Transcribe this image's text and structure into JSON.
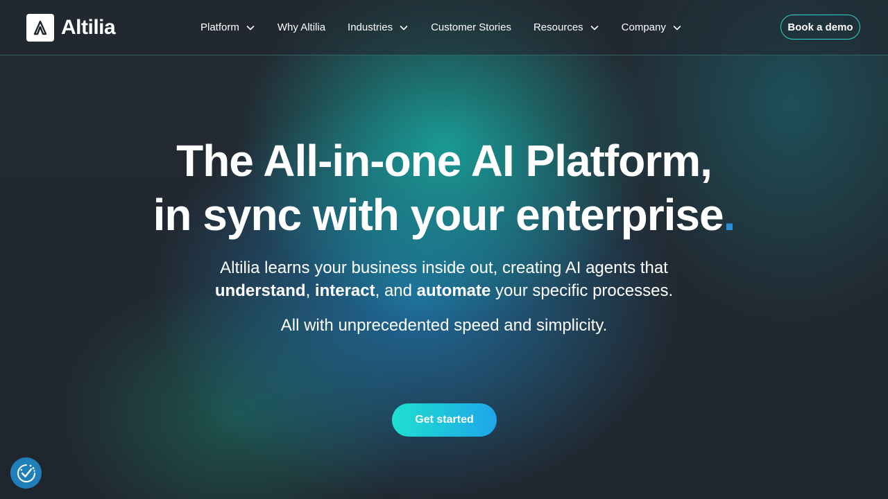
{
  "header": {
    "logo_text": "Altilia",
    "nav": [
      {
        "label": "Platform",
        "has_dropdown": true
      },
      {
        "label": "Why Altilia",
        "has_dropdown": false
      },
      {
        "label": "Industries",
        "has_dropdown": true
      },
      {
        "label": "Customer Stories",
        "has_dropdown": false
      },
      {
        "label": "Resources",
        "has_dropdown": true
      },
      {
        "label": "Company",
        "has_dropdown": true
      }
    ],
    "demo_label": "Book a demo"
  },
  "hero": {
    "title_line1": "The All-in-one AI Platform,",
    "title_line2": "in sync with your enterprise",
    "title_dot": ".",
    "sub_intro": "Altilia learns your business inside out, creating AI agents that",
    "sub_word1": "understand",
    "sub_sep1": ", ",
    "sub_word2": "interact",
    "sub_sep2": ", and ",
    "sub_word3": "automate",
    "sub_outro": " your specific processes.",
    "sub2": "All with unprecedented speed and simplicity.",
    "cta_label": "Get started"
  },
  "colors": {
    "accent_cyan": "#1ee0cf",
    "accent_blue": "#1fa5ea",
    "title_dot": "#2a8fd8",
    "background": "#20262f"
  },
  "icons": {
    "logo": "altilia-logo-icon",
    "dropdown": "chevron-down-icon",
    "consent": "cookie-consent-icon"
  }
}
